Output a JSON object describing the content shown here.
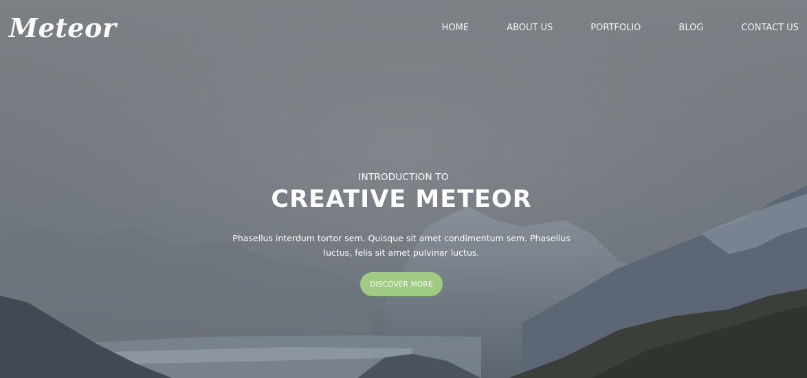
{
  "brand": {
    "logo_text": "Meteor"
  },
  "nav": {
    "items": [
      "HOME",
      "ABOUT US",
      "PORTFOLIO",
      "BLOG",
      "CONTACT US"
    ]
  },
  "hero": {
    "eyebrow": "INTRODUCTION TO",
    "title": "CREATIVE METEOR",
    "description": "Phasellus interdum tortor sem. Quisque sit amet condimentum sem. Phasellus luctus, felis sit amet pulvinar luctus.",
    "cta_label": "DISCOVER MORE"
  },
  "colors": {
    "overlay": "#6f7479",
    "cta_background": "#9fcb83",
    "text": "#ffffff"
  }
}
